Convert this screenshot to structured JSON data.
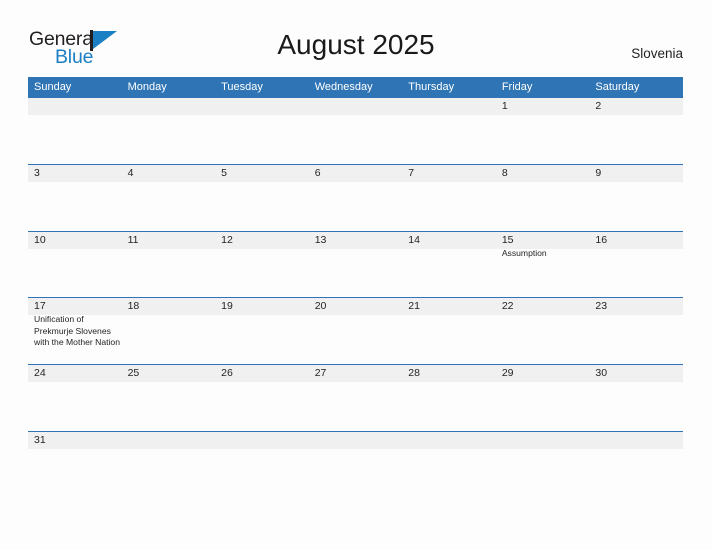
{
  "logo": {
    "word_one": "General",
    "word_two": "Blue"
  },
  "header": {
    "title": "August 2025",
    "region": "Slovenia"
  },
  "colors": {
    "header_blue": "#2f75b5",
    "band_gray": "#f0f0f0",
    "logo_blue": "#1b7fc4",
    "text_dark": "#231f20",
    "page_background": "#fdfdfd"
  },
  "calendar": {
    "day_names": [
      "Sunday",
      "Monday",
      "Tuesday",
      "Wednesday",
      "Thursday",
      "Friday",
      "Saturday"
    ],
    "weeks": [
      [
        {
          "day": "",
          "events": []
        },
        {
          "day": "",
          "events": []
        },
        {
          "day": "",
          "events": []
        },
        {
          "day": "",
          "events": []
        },
        {
          "day": "",
          "events": []
        },
        {
          "day": "1",
          "events": []
        },
        {
          "day": "2",
          "events": []
        }
      ],
      [
        {
          "day": "3",
          "events": []
        },
        {
          "day": "4",
          "events": []
        },
        {
          "day": "5",
          "events": []
        },
        {
          "day": "6",
          "events": []
        },
        {
          "day": "7",
          "events": []
        },
        {
          "day": "8",
          "events": []
        },
        {
          "day": "9",
          "events": []
        }
      ],
      [
        {
          "day": "10",
          "events": []
        },
        {
          "day": "11",
          "events": []
        },
        {
          "day": "12",
          "events": []
        },
        {
          "day": "13",
          "events": []
        },
        {
          "day": "14",
          "events": []
        },
        {
          "day": "15",
          "events": [
            "Assumption"
          ]
        },
        {
          "day": "16",
          "events": []
        }
      ],
      [
        {
          "day": "17",
          "events": [
            "Unification of Prekmurje Slovenes with the Mother Nation"
          ]
        },
        {
          "day": "18",
          "events": []
        },
        {
          "day": "19",
          "events": []
        },
        {
          "day": "20",
          "events": []
        },
        {
          "day": "21",
          "events": []
        },
        {
          "day": "22",
          "events": []
        },
        {
          "day": "23",
          "events": []
        }
      ],
      [
        {
          "day": "24",
          "events": []
        },
        {
          "day": "25",
          "events": []
        },
        {
          "day": "26",
          "events": []
        },
        {
          "day": "27",
          "events": []
        },
        {
          "day": "28",
          "events": []
        },
        {
          "day": "29",
          "events": []
        },
        {
          "day": "30",
          "events": []
        }
      ],
      [
        {
          "day": "31",
          "events": []
        },
        {
          "day": "",
          "events": []
        },
        {
          "day": "",
          "events": []
        },
        {
          "day": "",
          "events": []
        },
        {
          "day": "",
          "events": []
        },
        {
          "day": "",
          "events": []
        },
        {
          "day": "",
          "events": []
        }
      ]
    ]
  }
}
